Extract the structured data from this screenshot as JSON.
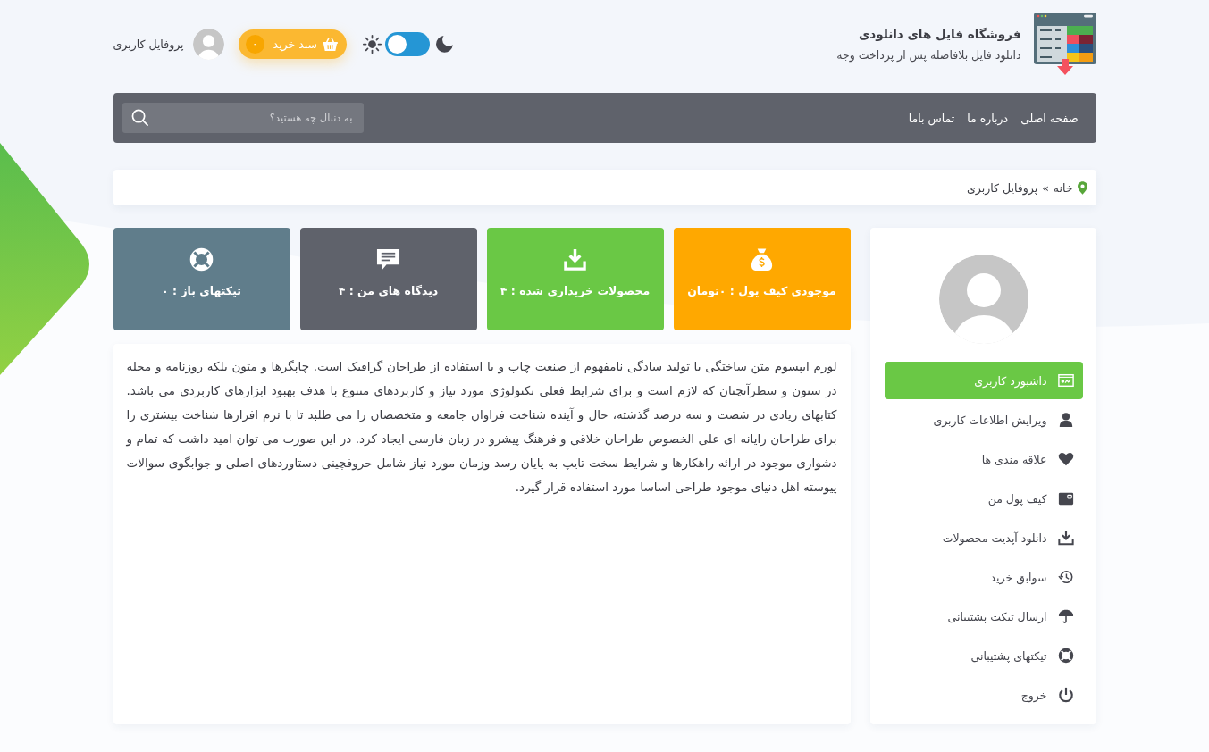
{
  "header": {
    "site_title": "فروشگاه فایل های دانلودی",
    "tagline": "دانلود فایل بلافاصله پس از پرداخت وجه",
    "theme_toggle": {
      "on": false
    },
    "cart": {
      "label": "سبد خرید",
      "count": "۰"
    },
    "profile_link": "پروفایل کاربری"
  },
  "nav": {
    "links": [
      "صفحه اصلی",
      "درباره ما",
      "تماس باما"
    ],
    "search": {
      "placeholder": "به دنبال چه هستید؟"
    }
  },
  "breadcrumb": {
    "items": [
      "خانه",
      "پروفایل کاربری"
    ],
    "separator": "»"
  },
  "stats": [
    {
      "label": "موجودی کیف پول : ۰تومان",
      "color": "#ffa800"
    },
    {
      "label": "محصولات خریداری شده : ۴",
      "color": "#6ac845"
    },
    {
      "label": "دیدگاه های من : ۴",
      "color": "#5f626b"
    },
    {
      "label": "تیکتهای باز : ۰",
      "color": "#607d8b"
    }
  ],
  "content": {
    "text": "لورم ایپسوم متن ساختگی با تولید سادگی نامفهوم از صنعت چاپ و با استفاده از طراحان گرافیک است. چاپگرها و متون بلکه روزنامه و مجله در ستون و سطرآنچنان که لازم است و برای شرایط فعلی تکنولوژی مورد نیاز و کاربردهای متنوع با هدف بهبود ابزارهای کاربردی می باشد. کتابهای زیادی در شصت و سه درصد گذشته، حال و آینده شناخت فراوان جامعه و متخصصان را می طلبد تا با نرم افزارها شناخت بیشتری را برای طراحان رایانه ای علی الخصوص طراحان خلاقی و فرهنگ پیشرو در زبان فارسی ایجاد کرد. در این صورت می توان امید داشت که تمام و دشواری موجود در ارائه راهکارها و شرایط سخت تایپ به پایان رسد وزمان مورد نیاز شامل حروفچینی دستاوردهای اصلی و جوابگوی سوالات پیوسته اهل دنیای موجود طراحی اساسا مورد استفاده قرار گیرد."
  },
  "sidebar": {
    "items": [
      {
        "label": "داشبورد کاربری",
        "selected": true
      },
      {
        "label": "ویرایش اطلاعات کاربری",
        "selected": false
      },
      {
        "label": "علاقه مندی ها",
        "selected": false
      },
      {
        "label": "کیف پول من",
        "selected": false
      },
      {
        "label": "دانلود آپدیت محصولات",
        "selected": false
      },
      {
        "label": "سوابق خرید",
        "selected": false
      },
      {
        "label": "ارسال تیکت پشتیبانی",
        "selected": false
      },
      {
        "label": "تیکتهای پشتیبانی",
        "selected": false
      },
      {
        "label": "خروج",
        "selected": false
      }
    ]
  }
}
